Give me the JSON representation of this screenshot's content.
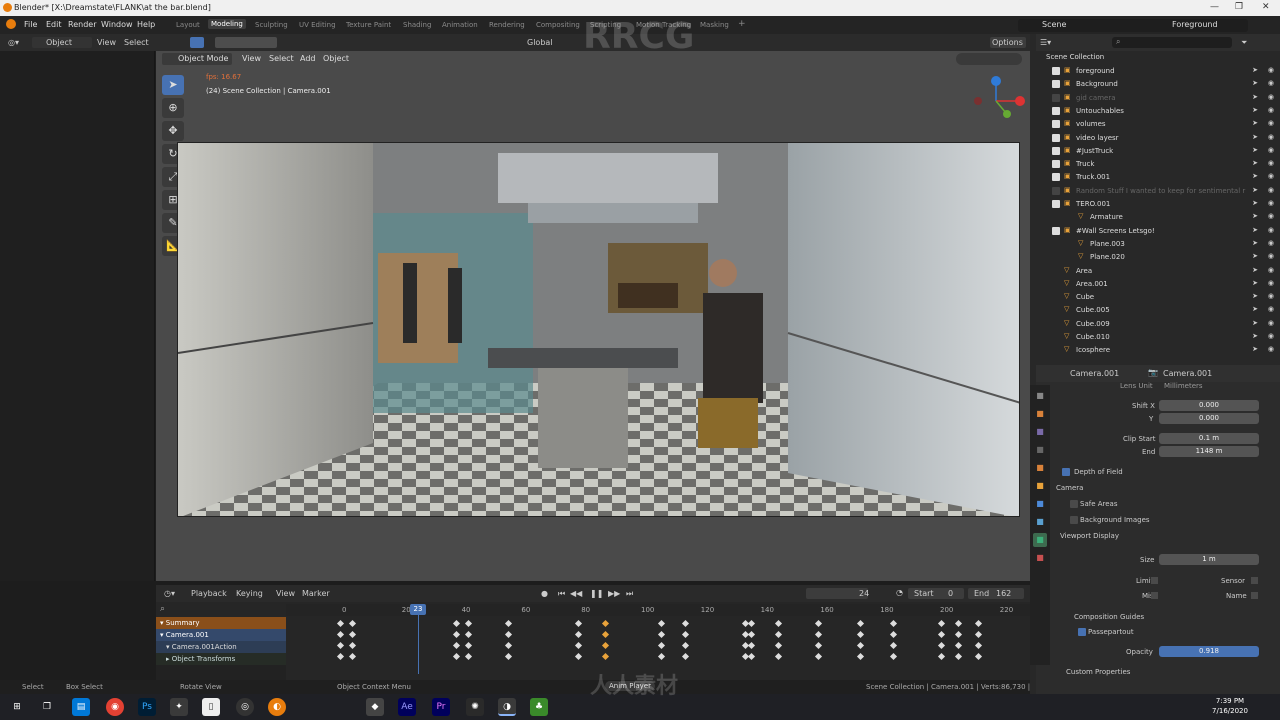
{
  "window": {
    "title": "Blender* [X:\\Dreamstate\\FLANK\\at the bar.blend]",
    "minimize": "—",
    "maximize": "❐",
    "close": "✕"
  },
  "menubar": {
    "menus": [
      "File",
      "Edit",
      "Render",
      "Window",
      "Help"
    ],
    "workspaces": [
      "Layout",
      "Modeling",
      "Sculpting",
      "UV Editing",
      "Texture Paint",
      "Shading",
      "Animation",
      "Rendering",
      "Compositing",
      "Scripting",
      "Motion Tracking",
      "Masking"
    ],
    "active_workspace": "Modeling",
    "add_tab": "+",
    "scene_label": "Scene",
    "viewlayer_label": "Foreground"
  },
  "toolheader": {
    "object": "Object",
    "view": "View",
    "select": "Select",
    "orientation": "Global",
    "options": "Options"
  },
  "viewport_header": {
    "mode": "Object Mode",
    "items": [
      "View",
      "Select",
      "Add",
      "Object"
    ]
  },
  "overlay": {
    "fps": "fps: 16.67",
    "camera_text": "(24) Scene Collection | Camera.001"
  },
  "tools": [
    {
      "icon": "select-cursor-icon",
      "glyph": "➤",
      "active": true
    },
    {
      "icon": "cursor-icon",
      "glyph": "⊕",
      "active": false
    },
    {
      "icon": "move-icon",
      "glyph": "✥",
      "active": false
    },
    {
      "icon": "rotate-icon",
      "glyph": "↻",
      "active": false
    },
    {
      "icon": "scale-icon",
      "glyph": "⤢",
      "active": false
    },
    {
      "icon": "transform-icon",
      "glyph": "⊞",
      "active": false
    },
    {
      "icon": "annotate-icon",
      "glyph": "✎",
      "active": false
    },
    {
      "icon": "measure-icon",
      "glyph": "📐",
      "active": false
    }
  ],
  "timeline": {
    "menus": [
      "Playback",
      "Keying",
      "View",
      "Marker"
    ],
    "current_frame": "24",
    "start_label": "Start",
    "start": "0",
    "end_label": "End",
    "end": "162",
    "playhead": "23",
    "ruler": [
      "0",
      "20",
      "40",
      "60",
      "80",
      "100",
      "120",
      "140",
      "160",
      "180",
      "200",
      "220"
    ],
    "channels": [
      "Summary",
      "Camera.001",
      "Camera.001Action",
      "Object Transforms"
    ]
  },
  "statusbar": {
    "select": "Select",
    "box_select": "Box Select",
    "rotate": "Rotate View",
    "context": "Object Context Menu",
    "anim": "Anim Player",
    "info": "Scene Collection | Camera.001 | Verts:86,730 | Faces:68,387 | Tris:144,666 | Objects:1/68 | Mem: 2.31 GiB | 2.83.2"
  },
  "outliner": {
    "title": "Scene Collection",
    "items": [
      {
        "name": "foreground",
        "checked": true,
        "indent": 1
      },
      {
        "name": "Background",
        "checked": true,
        "indent": 1
      },
      {
        "name": "gid camera",
        "checked": false,
        "indent": 1,
        "dim": true
      },
      {
        "name": "Untouchables",
        "checked": true,
        "indent": 1
      },
      {
        "name": "volumes",
        "checked": true,
        "indent": 1
      },
      {
        "name": "video layesr",
        "checked": true,
        "indent": 1
      },
      {
        "name": "#JustTruck",
        "checked": true,
        "indent": 1
      },
      {
        "name": "Truck",
        "checked": true,
        "indent": 1
      },
      {
        "name": "Truck.001",
        "checked": true,
        "indent": 1
      },
      {
        "name": "Random Stuff I wanted to keep for sentimental r",
        "checked": false,
        "indent": 1,
        "dim": true
      },
      {
        "name": "TERO.001",
        "checked": true,
        "indent": 1
      },
      {
        "name": "Armature",
        "checked": null,
        "indent": 2
      },
      {
        "name": "#Wall Screens Letsgo!",
        "checked": true,
        "indent": 1
      },
      {
        "name": "Plane.003",
        "checked": null,
        "indent": 2
      },
      {
        "name": "Plane.020",
        "checked": null,
        "indent": 2
      },
      {
        "name": "Area",
        "checked": null,
        "indent": 1
      },
      {
        "name": "Area.001",
        "checked": null,
        "indent": 1
      },
      {
        "name": "Cube",
        "checked": null,
        "indent": 1
      },
      {
        "name": "Cube.005",
        "checked": null,
        "indent": 1
      },
      {
        "name": "Cube.009",
        "checked": null,
        "indent": 1
      },
      {
        "name": "Cube.010",
        "checked": null,
        "indent": 1
      },
      {
        "name": "Icosphere",
        "checked": null,
        "indent": 1
      }
    ]
  },
  "properties": {
    "object_name": "Camera.001",
    "data_name": "Camera.001",
    "lens_unit": "Lens Unit",
    "lens_unit_value": "Millimeters",
    "shift_x_label": "Shift X",
    "shift_x": "0.000",
    "shift_y_label": "Y",
    "shift_y": "0.000",
    "clip_start_label": "Clip Start",
    "clip_start": "0.1 m",
    "clip_end_label": "End",
    "clip_end": "1148 m",
    "depth_of_field": "Depth of Field",
    "camera": "Camera",
    "safe_areas": "Safe Areas",
    "background_images": "Background Images",
    "viewport_display": "Viewport Display",
    "size_label": "Size",
    "size": "1 m",
    "limits": "Limits",
    "sensor": "Sensor",
    "mist": "Mist",
    "name": "Name",
    "composition_guides": "Composition Guides",
    "passepartout": "Passepartout",
    "opacity_label": "Opacity",
    "opacity": "0.918",
    "custom_properties": "Custom Properties"
  },
  "taskbar": {
    "time": "7:39 PM",
    "date": "7/16/2020"
  },
  "watermarks": [
    "RRCG",
    "人人素材"
  ],
  "colors": {
    "accent": "#4772b3",
    "active_key": "#e8a23a",
    "summary": "#d97a20"
  }
}
